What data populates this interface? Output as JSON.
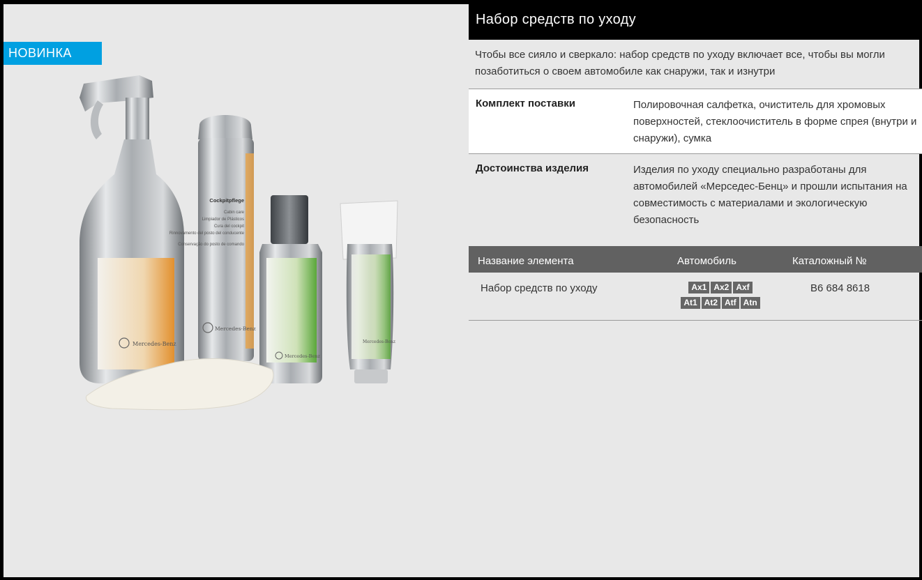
{
  "header": {
    "title": "Набор средств по уходу"
  },
  "badge": {
    "label": "НОВИНКА"
  },
  "intro": {
    "text": "Чтобы все сияло и сверкало: набор средств по уходу включает все, чтобы вы могли позаботиться о своем автомобиле как снаружи, так и изнутри"
  },
  "specs": [
    {
      "label": "Комплект поставки",
      "value": "Полировочная салфетка, очиститель для хромовых поверхностей, стеклоочиститель в форме спрея (внутри и снаружи), сумка"
    },
    {
      "label": "Достоинства изделия",
      "value": "Изделия по уходу специально разработаны для автомобилей «Мерседес-Бенц» и прошли испытания на совместимость с материалами и экологическую безопасность"
    }
  ],
  "parts": {
    "headers": {
      "name": "Название элемента",
      "vehicle": "Автомобиль",
      "catalog": "Каталожный №"
    },
    "rows": [
      {
        "name": "Набор средств по уходу",
        "vehicles": [
          "Ax1",
          "Ax2",
          "Axf",
          "At1",
          "At2",
          "Atf",
          "Atn"
        ],
        "catalog": "B6 684 8618"
      }
    ]
  },
  "product_labels": {
    "can_title": "Cockpitpflege",
    "can_lines": [
      "Cabin care",
      "Limpiador de Plásticos",
      "Cura del cockpit",
      "Rinnovamento del posto del conducente",
      "Conservação do posto de comando"
    ],
    "can_brand": "Mercedes-Benz",
    "spray_brand": "Mercedes-Benz",
    "bottle_brand": "Mercedes-Benz",
    "tube_brand": "Mercedes-Benz"
  },
  "colors": {
    "badge": "#00a0e1",
    "header_bg": "#000000",
    "table_head": "#616161",
    "page_bg": "#e8e8e8"
  }
}
